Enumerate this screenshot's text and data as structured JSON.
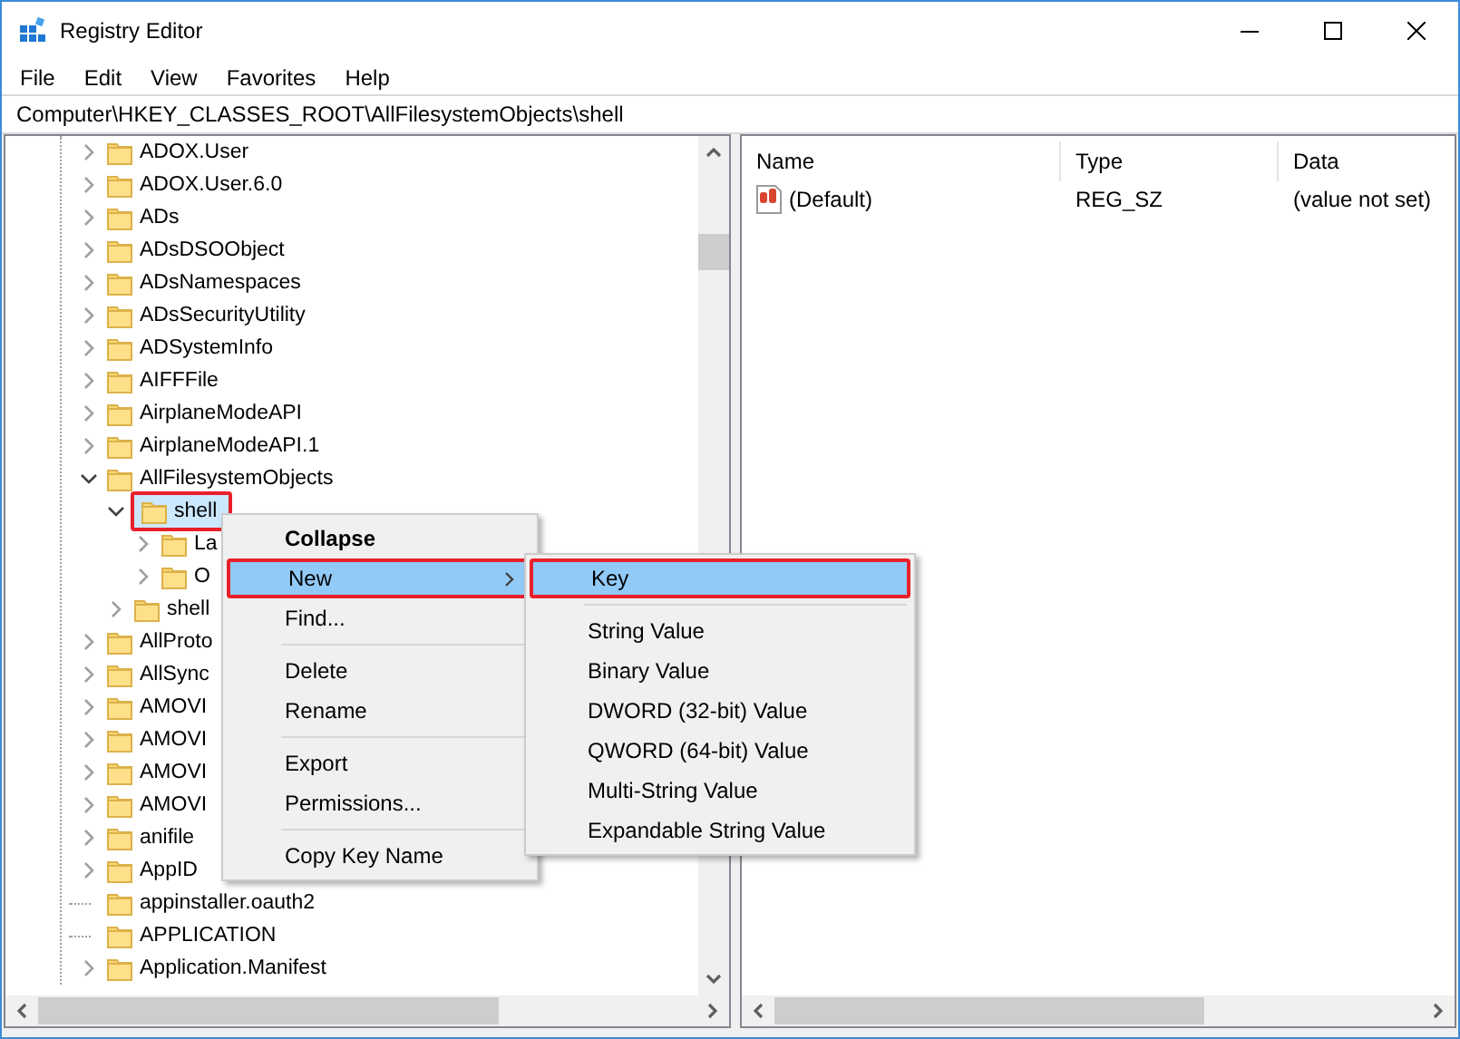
{
  "window": {
    "title": "Registry Editor"
  },
  "menu_bar": [
    {
      "label": "File"
    },
    {
      "label": "Edit"
    },
    {
      "label": "View"
    },
    {
      "label": "Favorites"
    },
    {
      "label": "Help"
    }
  ],
  "address_bar": {
    "value": "Computer\\HKEY_CLASSES_ROOT\\AllFilesystemObjects\\shell"
  },
  "tree": [
    {
      "label": "ADOX.User",
      "expandable": true,
      "expanded": false,
      "selected": false,
      "annotated": false
    },
    {
      "label": "ADOX.User.6.0",
      "expandable": true,
      "expanded": false,
      "selected": false,
      "annotated": false
    },
    {
      "label": "ADs",
      "expandable": true,
      "expanded": false,
      "selected": false,
      "annotated": false
    },
    {
      "label": "ADsDSOObject",
      "expandable": true,
      "expanded": false,
      "selected": false,
      "annotated": false
    },
    {
      "label": "ADsNamespaces",
      "expandable": true,
      "expanded": false,
      "selected": false,
      "annotated": false
    },
    {
      "label": "ADsSecurityUtility",
      "expandable": true,
      "expanded": false,
      "selected": false,
      "annotated": false
    },
    {
      "label": "ADSystemInfo",
      "expandable": true,
      "expanded": false,
      "selected": false,
      "annotated": false
    },
    {
      "label": "AIFFFile",
      "expandable": true,
      "expanded": false,
      "selected": false,
      "annotated": false
    },
    {
      "label": "AirplaneModeAPI",
      "expandable": true,
      "expanded": false,
      "selected": false,
      "annotated": false
    },
    {
      "label": "AirplaneModeAPI.1",
      "expandable": true,
      "expanded": false,
      "selected": false,
      "annotated": false
    },
    {
      "label": "AllFilesystemObjects",
      "expandable": true,
      "expanded": true,
      "selected": false,
      "annotated": false,
      "children": [
        {
          "label": "shell",
          "expandable": true,
          "expanded": true,
          "selected": true,
          "annotated": true,
          "children": [
            {
              "label": "La",
              "expandable": true,
              "expanded": false,
              "selected": false,
              "annotated": false
            },
            {
              "label": "O",
              "expandable": true,
              "expanded": false,
              "selected": false,
              "annotated": false
            }
          ]
        },
        {
          "label": "shell",
          "expandable": true,
          "expanded": false,
          "selected": false,
          "annotated": false
        }
      ]
    },
    {
      "label": "AllProto",
      "expandable": true,
      "expanded": false,
      "selected": false,
      "annotated": false
    },
    {
      "label": "AllSync",
      "expandable": true,
      "expanded": false,
      "selected": false,
      "annotated": false
    },
    {
      "label": "AMOVI",
      "expandable": true,
      "expanded": false,
      "selected": false,
      "annotated": false
    },
    {
      "label": "AMOVI",
      "expandable": true,
      "expanded": false,
      "selected": false,
      "annotated": false
    },
    {
      "label": "AMOVI",
      "expandable": true,
      "expanded": false,
      "selected": false,
      "annotated": false
    },
    {
      "label": "AMOVI",
      "expandable": true,
      "expanded": false,
      "selected": false,
      "annotated": false
    },
    {
      "label": "anifile",
      "expandable": true,
      "expanded": false,
      "selected": false,
      "annotated": false
    },
    {
      "label": "AppID",
      "expandable": true,
      "expanded": false,
      "selected": false,
      "annotated": false
    },
    {
      "label": "appinstaller.oauth2",
      "expandable": false,
      "selected": false,
      "annotated": false
    },
    {
      "label": "APPLICATION",
      "expandable": false,
      "selected": false,
      "annotated": false
    },
    {
      "label": "Application.Manifest",
      "expandable": true,
      "expanded": false,
      "selected": false,
      "annotated": false
    }
  ],
  "values_table": {
    "columns": [
      "Name",
      "Type",
      "Data"
    ],
    "rows": [
      {
        "name": "(Default)",
        "type": "REG_SZ",
        "data": "(value not set)"
      }
    ]
  },
  "context_menu": {
    "items": [
      {
        "kind": "item",
        "label": "Collapse",
        "bold": true,
        "selected": false,
        "annotated": false,
        "has_submenu": false
      },
      {
        "kind": "item",
        "label": "New",
        "bold": false,
        "selected": true,
        "annotated": true,
        "has_submenu": true
      },
      {
        "kind": "item",
        "label": "Find...",
        "bold": false,
        "selected": false,
        "annotated": false,
        "has_submenu": false
      },
      {
        "kind": "separator"
      },
      {
        "kind": "item",
        "label": "Delete",
        "bold": false,
        "selected": false,
        "annotated": false,
        "has_submenu": false
      },
      {
        "kind": "item",
        "label": "Rename",
        "bold": false,
        "selected": false,
        "annotated": false,
        "has_submenu": false
      },
      {
        "kind": "separator"
      },
      {
        "kind": "item",
        "label": "Export",
        "bold": false,
        "selected": false,
        "annotated": false,
        "has_submenu": false
      },
      {
        "kind": "item",
        "label": "Permissions...",
        "bold": false,
        "selected": false,
        "annotated": false,
        "has_submenu": false
      },
      {
        "kind": "separator"
      },
      {
        "kind": "item",
        "label": "Copy Key Name",
        "bold": false,
        "selected": false,
        "annotated": false,
        "has_submenu": false
      }
    ]
  },
  "submenu": {
    "items": [
      {
        "kind": "item",
        "label": "Key",
        "bold": false,
        "selected": true,
        "annotated": true,
        "has_submenu": false
      },
      {
        "kind": "separator"
      },
      {
        "kind": "item",
        "label": "String Value",
        "bold": false,
        "selected": false,
        "annotated": false,
        "has_submenu": false
      },
      {
        "kind": "item",
        "label": "Binary Value",
        "bold": false,
        "selected": false,
        "annotated": false,
        "has_submenu": false
      },
      {
        "kind": "item",
        "label": "DWORD (32-bit) Value",
        "bold": false,
        "selected": false,
        "annotated": false,
        "has_submenu": false
      },
      {
        "kind": "item",
        "label": "QWORD (64-bit) Value",
        "bold": false,
        "selected": false,
        "annotated": false,
        "has_submenu": false
      },
      {
        "kind": "item",
        "label": "Multi-String Value",
        "bold": false,
        "selected": false,
        "annotated": false,
        "has_submenu": false
      },
      {
        "kind": "item",
        "label": "Expandable String Value",
        "bold": false,
        "selected": false,
        "annotated": false,
        "has_submenu": false
      }
    ]
  }
}
